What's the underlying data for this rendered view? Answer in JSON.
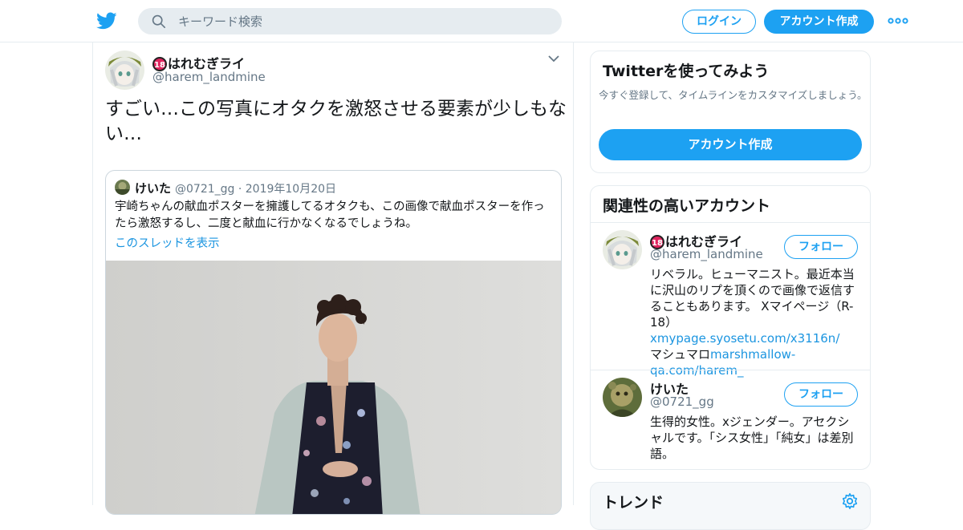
{
  "header": {
    "logo_icon": "twitter-bird-icon",
    "search_placeholder": "キーワード検索",
    "login_label": "ログイン",
    "signup_label": "アカウント作成",
    "more_icon": "more-dots-icon",
    "brand_color": "#1da1f2"
  },
  "tweet": {
    "author_badge": "18",
    "author_name": "はれむぎライ",
    "author_handle": "@harem_landmine",
    "text": "すごい…この写真にオタクを激怒させる要素が少しもない…",
    "caret_icon": "chevron-down-icon",
    "quote": {
      "author_name": "けいた",
      "author_handle": "@0721_gg",
      "separator": "·",
      "date": "2019年10月20日",
      "text": "宇崎ちゃんの献血ポスターを擁護してるオタクも、この画像で献血ポスターを作ったら激怒するし、二度と献血に行かなくなるでしょうね。",
      "thread_link": "このスレッドを表示"
    }
  },
  "sidebar": {
    "signup_card": {
      "title": "Twitterを使ってみよう",
      "subtitle": "今すぐ登録して、タイムラインをカスタマイズしましょう。",
      "button": "アカウント作成"
    },
    "related": {
      "title": "関連性の高いアカウント",
      "accounts": [
        {
          "badge": "18",
          "name": "はれむぎライ",
          "handle": "@harem_landmine",
          "follow_label": "フォロー",
          "bio_text": "リベラル。ヒューマニスト。最近本当に沢山のリプを頂くので画像で返信することもあります。 Xマイページ（R-18）",
          "bio_link1": "xmypage.syosetu.com/x3116n/",
          "bio_text2": "マシュマロ",
          "bio_link2": "marshmallow-qa.com/harem_"
        },
        {
          "name": "けいた",
          "handle": "@0721_gg",
          "follow_label": "フォロー",
          "bio_text": "生得的女性。xジェンダー。アセクシャルです。「シス女性」「純女」は差別語。"
        }
      ]
    },
    "trends": {
      "title": "トレンド",
      "settings_icon": "gear-icon"
    }
  }
}
